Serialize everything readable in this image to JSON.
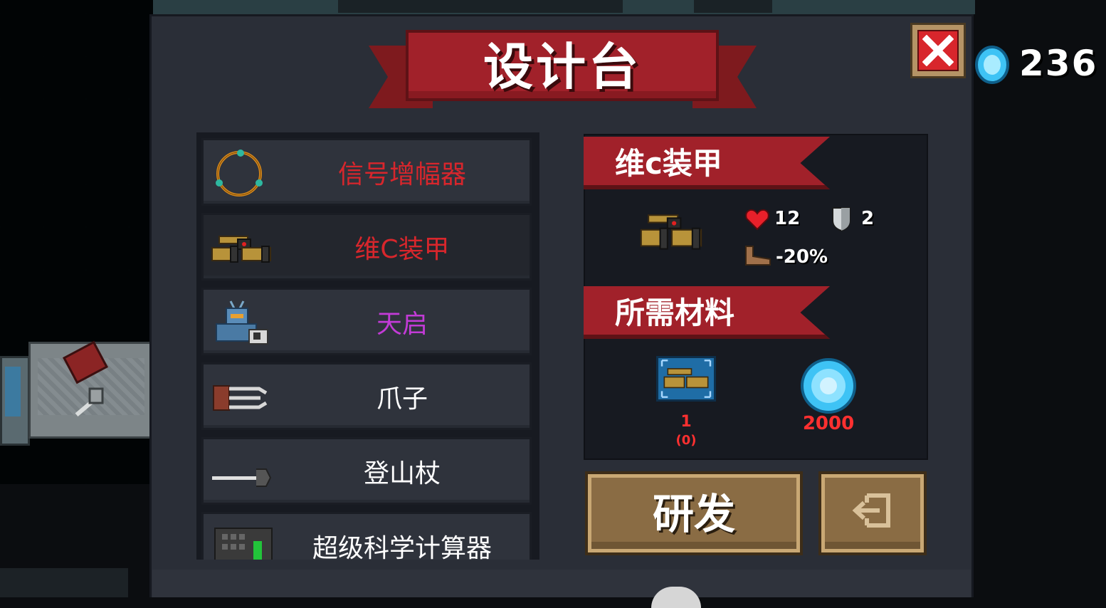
{
  "header": {
    "title": "设计台",
    "close_label": "关闭"
  },
  "currency": {
    "gems": "236",
    "gem_color": "#29a8e6"
  },
  "blueprint_list": {
    "items": [
      {
        "label": "信号增幅器",
        "color": "#d8262c",
        "icon": "ring-icon"
      },
      {
        "label": "维C装甲",
        "color": "#d8262c",
        "icon": "armor-icon",
        "selected": true
      },
      {
        "label": "天启",
        "color": "#c23bd6",
        "icon": "mech-icon"
      },
      {
        "label": "爪子",
        "color": "#ffffff",
        "icon": "claw-icon"
      },
      {
        "label": "登山杖",
        "color": "#ffffff",
        "icon": "staff-icon"
      },
      {
        "label": "超级科学计算器",
        "color": "#ffffff",
        "icon": "calculator-icon"
      }
    ]
  },
  "detail": {
    "item_name": "维c装甲",
    "stats": {
      "hp": "12",
      "armor": "2",
      "speed": "-20%"
    },
    "materials_header": "所需材料",
    "materials": [
      {
        "icon": "blueprint-icon",
        "qty": "1",
        "owned": "(0)"
      },
      {
        "icon": "gem-icon",
        "qty": "2000"
      }
    ]
  },
  "actions": {
    "craft_label": "研发",
    "exit_icon": "exit-icon"
  }
}
